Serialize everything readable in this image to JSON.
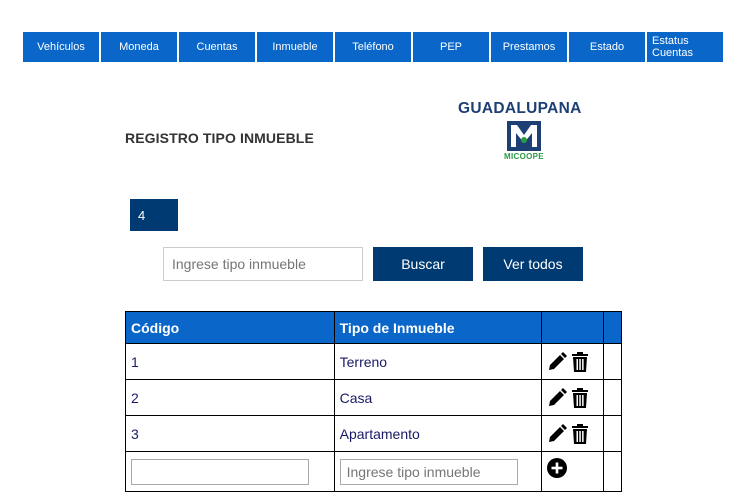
{
  "nav": {
    "items": [
      {
        "label": "Vehículos"
      },
      {
        "label": "Moneda"
      },
      {
        "label": "Cuentas"
      },
      {
        "label": "Inmueble"
      },
      {
        "label": "Teléfono"
      },
      {
        "label": "PEP"
      },
      {
        "label": "Prestamos"
      },
      {
        "label": "Estado"
      },
      {
        "label": "Estatus Cuentas"
      }
    ]
  },
  "header": {
    "title": "REGISTRO TIPO INMUEBLE",
    "logo_text": "GUADALUPANA",
    "logo_sub": "MICOOPE"
  },
  "count": "4",
  "search": {
    "placeholder": "Ingrese tipo inmueble",
    "search_button": "Buscar",
    "view_all_button": "Ver todos"
  },
  "table": {
    "headers": [
      "Código",
      "Tipo de Inmueble",
      "",
      ""
    ],
    "rows": [
      {
        "code": "1",
        "type": "Terreno"
      },
      {
        "code": "2",
        "type": "Casa"
      },
      {
        "code": "3",
        "type": "Apartamento"
      }
    ],
    "new_row": {
      "code_value": "",
      "type_placeholder": "Ingrese tipo inmueble"
    }
  },
  "colors": {
    "nav_bg": "#0a66c8",
    "button_bg": "#003a73",
    "header_bg": "#0a66c8",
    "logo_text": "#1d3f74",
    "logo_sub": "#2c9a47"
  },
  "icons": {
    "edit": "pencil-icon",
    "delete": "trash-icon",
    "add": "plus-circle-icon"
  }
}
